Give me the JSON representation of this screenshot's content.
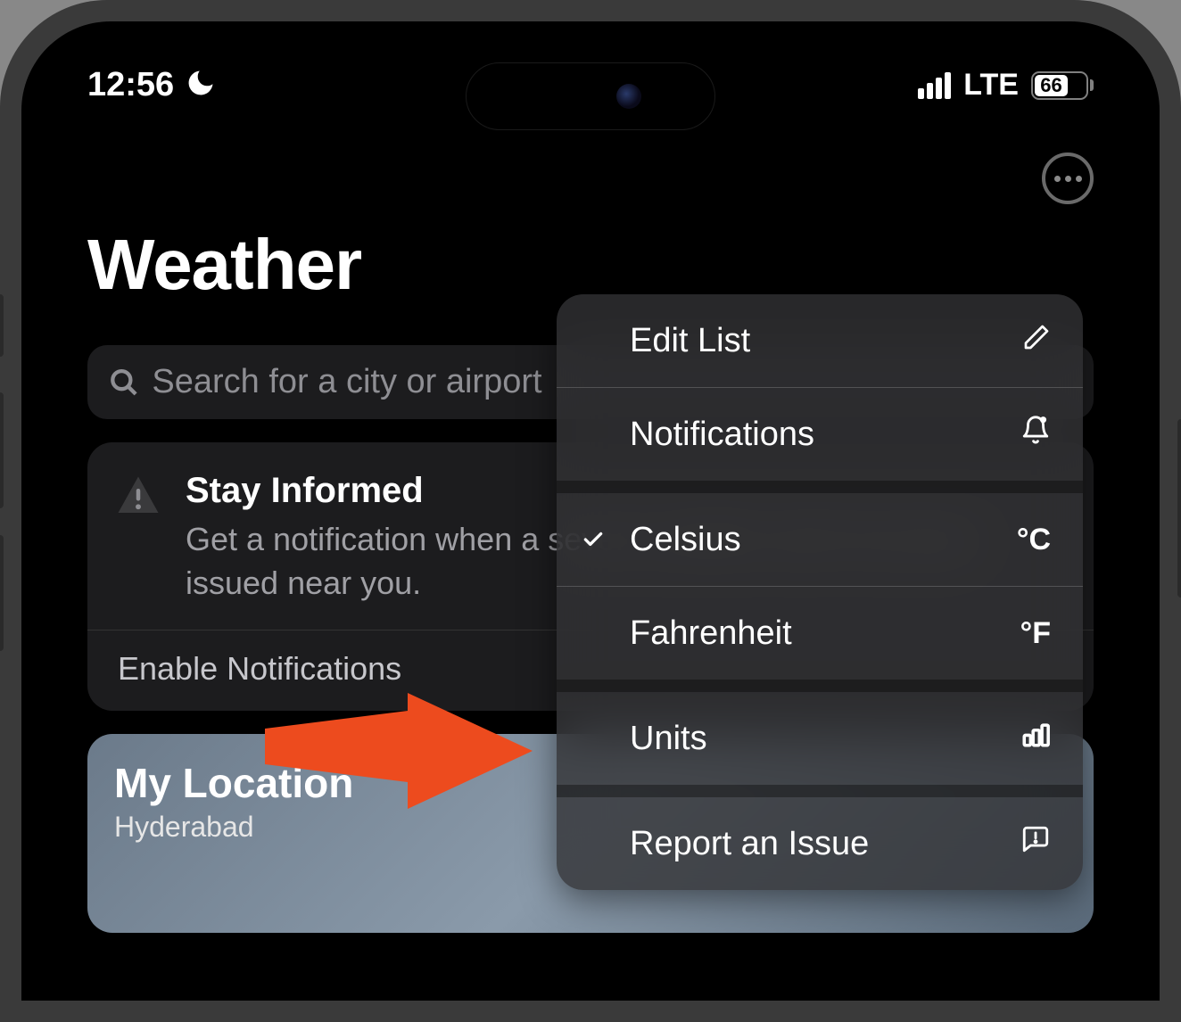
{
  "status_bar": {
    "time": "12:56",
    "network": "LTE",
    "battery_percent": "66"
  },
  "page_title": "Weather",
  "search": {
    "placeholder": "Search for a city or airport"
  },
  "info_card": {
    "title": "Stay Informed",
    "body": "Get a notification when a severe weather alert has been issued near you.",
    "action": "Enable Notifications"
  },
  "location_card": {
    "title": "My Location",
    "subtitle": "Hyderabad"
  },
  "menu": {
    "edit_list": "Edit List",
    "notifications": "Notifications",
    "celsius": "Celsius",
    "celsius_symbol": "°C",
    "fahrenheit": "Fahrenheit",
    "fahrenheit_symbol": "°F",
    "units": "Units",
    "report_issue": "Report an Issue"
  }
}
